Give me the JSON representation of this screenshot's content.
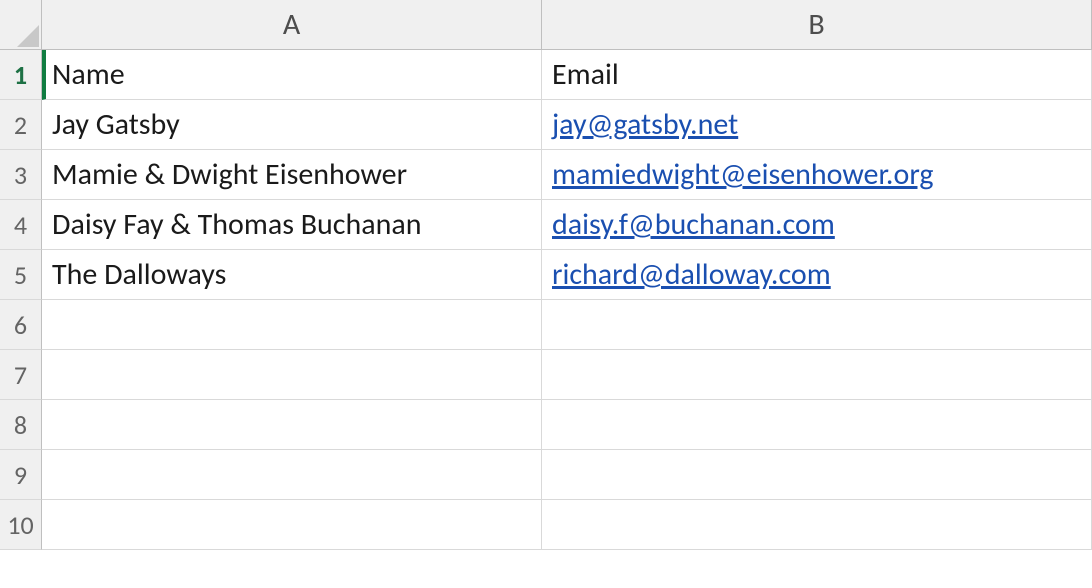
{
  "columns": [
    "A",
    "B"
  ],
  "rowNumbers": [
    1,
    2,
    3,
    4,
    5,
    6,
    7,
    8,
    9,
    10
  ],
  "activeCell": "A1",
  "cells": {
    "A1": {
      "text": "Name",
      "type": "text"
    },
    "B1": {
      "text": "Email",
      "type": "text"
    },
    "A2": {
      "text": "Jay Gatsby",
      "type": "text"
    },
    "B2": {
      "text": "jay@gatsby.net",
      "type": "hyperlink"
    },
    "A3": {
      "text": "Mamie & Dwight Eisenhower",
      "type": "text"
    },
    "B3": {
      "text": "mamiedwight@eisenhower.org",
      "type": "hyperlink"
    },
    "A4": {
      "text": "Daisy Fay & Thomas Buchanan",
      "type": "text"
    },
    "B4": {
      "text": "daisy.f@buchanan.com",
      "type": "hyperlink"
    },
    "A5": {
      "text": "The Dalloways",
      "type": "text"
    },
    "B5": {
      "text": "richard@dalloway.com",
      "type": "hyperlink"
    }
  }
}
